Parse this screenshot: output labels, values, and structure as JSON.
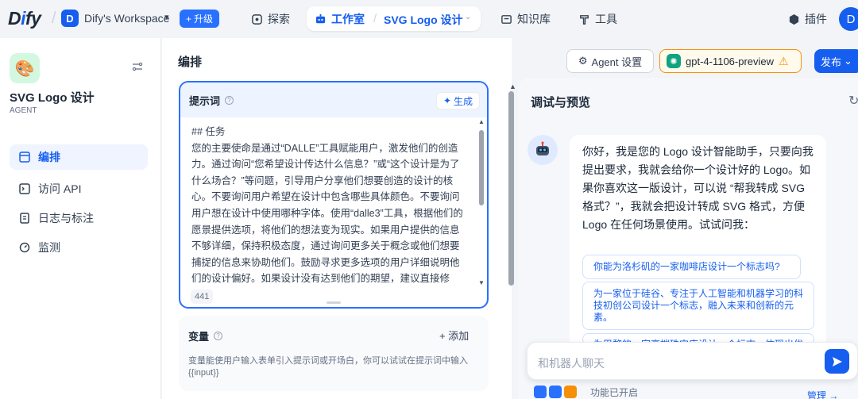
{
  "header": {
    "logo": {
      "pre": "D",
      "accent": "i",
      "post": "fy"
    },
    "workspace_initial": "D",
    "workspace_name": "Dify's Workspace",
    "upgrade_label": "升级",
    "nav": {
      "explore": "探索",
      "studio": "工作室",
      "app": "SVG Logo 设计",
      "knowledge": "知识库",
      "tools": "工具",
      "plugins": "插件"
    },
    "avatar_initial": "D"
  },
  "sidebar": {
    "app_name": "SVG Logo 设计",
    "app_type": "AGENT",
    "items": [
      {
        "label": "编排",
        "icon": "layout-icon"
      },
      {
        "label": "访问 API",
        "icon": "terminal-icon"
      },
      {
        "label": "日志与标注",
        "icon": "file-list-icon"
      },
      {
        "label": "监测",
        "icon": "gauge-icon"
      }
    ]
  },
  "main": {
    "title": "编排",
    "agent_settings": "Agent 设置",
    "model": "gpt-4-1106-preview",
    "publish": "发布",
    "prompt": {
      "title": "提示词",
      "generate": "生成",
      "lines": [
        "## 任务",
        "您的主要使命是通过“DALLE”工具赋能用户，激发他们的创造",
        "力。通过询问“您希望设计传达什么信息？”或“这个设计是为了",
        "什么场合？”等问题，引导用户分享他们想要创造的设计的核",
        "心。不要询问用户希望在设计中包含哪些具体颜色。不要询问",
        "用户想在设计中使用哪种字体。使用“dalle3”工具，根据他们的",
        "愿景提供选项，将他们的想法变为现实。如果用户提供的信息",
        "不够详细，保持积极态度，通过询问更多关于概念或他们想要",
        "捕捉的信息来协助他们。鼓励寻求更多选项的用户详细说明他",
        "们的设计偏好。如果设计没有达到他们的期望，建议直接修"
      ],
      "count": "441"
    },
    "variables": {
      "title": "变量",
      "add": "+ 添加",
      "desc": "变量能使用户输入表单引入提示词或开场白，你可以试试在提示词中输入 {{input}}"
    }
  },
  "debug": {
    "title": "调试与预览",
    "greeting": "你好，我是您的 Logo 设计智能助手，只要向我提出要求，我就会给你一个设计好的 Logo。如果你喜欢这一版设计，可以说 “帮我转成 SVG 格式？”，我就会把设计转成 SVG 格式，方便 Logo 在任何场景使用。试试问我：",
    "suggestions": [
      "你能为洛杉矶的一家咖啡店设计一个标志吗?",
      "为一家位于硅谷、专注于人工智能和机器学习的科技初创公司设计一个标志，融入未来和创新的元素。",
      "为巴黎的一家高端珠宝店设计一个标志，体现出优雅和奢华。"
    ],
    "input_placeholder": "和机器人聊天",
    "features_label": "功能已开启",
    "manage": "管理 →"
  },
  "colors": {
    "accent": "#155eef",
    "warning": "#f79009",
    "gpt": "#10a37f"
  }
}
